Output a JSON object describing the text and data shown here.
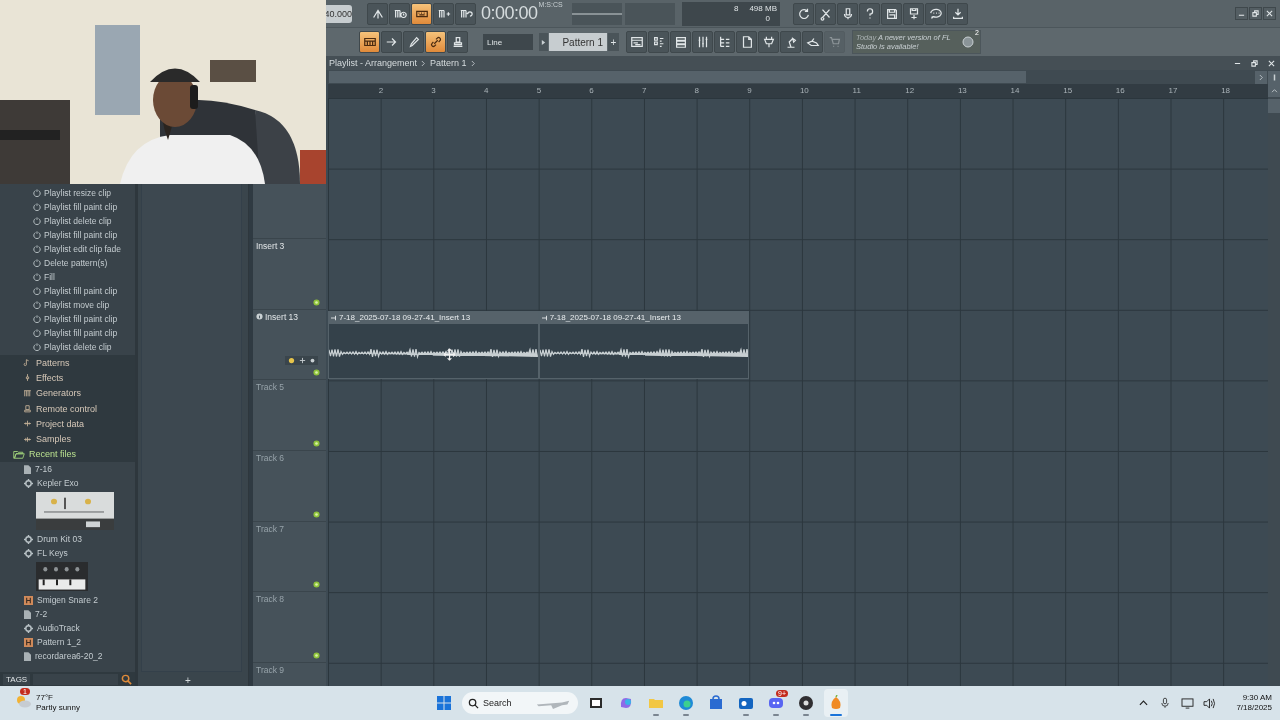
{
  "toolbar": {
    "tempo": "40.000",
    "buttons_row1": [
      {
        "on": false
      },
      {
        "on": false
      },
      {
        "on": true
      },
      {
        "on": false
      },
      {
        "on": false
      }
    ],
    "time": "0:00:00",
    "time_format": "M:S:CS",
    "cpu": "8",
    "memory": "498 MB",
    "polyphony": "0",
    "buttons_row2": [
      {
        "on": true
      },
      {
        "on": false
      },
      {
        "on": false
      },
      {
        "on": true
      },
      {
        "on": false
      }
    ],
    "snap": "Line",
    "pattern": "Pattern 1",
    "add": "+",
    "tools": [
      {
        "disabled": false
      },
      {
        "disabled": false
      },
      {
        "disabled": false
      },
      {
        "disabled": false
      },
      {
        "disabled": false
      },
      {
        "disabled": false
      },
      {
        "disabled": false
      },
      {
        "disabled": false
      },
      {
        "disabled": false
      },
      {
        "disabled": true
      }
    ],
    "news": {
      "date": "Today",
      "message": "A newer version of FL Studio is available!",
      "badge": "2"
    }
  },
  "browser": {
    "history": [
      "Playlist resize clip",
      "Playlist fill paint clip",
      "Playlist delete clip",
      "Playlist fill paint clip",
      "Playlist edit clip fade",
      "Delete pattern(s)",
      "Fill",
      "Playlist fill paint clip",
      "Playlist move clip",
      "Playlist fill paint clip",
      "Playlist fill paint clip",
      "Playlist delete clip"
    ],
    "folders": [
      {
        "label": "Patterns",
        "kind": "patterns"
      },
      {
        "label": "Effects",
        "kind": "effects"
      },
      {
        "label": "Generators",
        "kind": "generators"
      },
      {
        "label": "Remote control",
        "kind": "remote"
      },
      {
        "label": "Project data",
        "kind": "project"
      },
      {
        "label": "Samples",
        "kind": "samples"
      }
    ],
    "recent_files": {
      "label": "Recent files",
      "expanded": true,
      "children": [
        {
          "label": "7-16",
          "kind": "file"
        },
        {
          "label": "Kepler Exo",
          "kind": "plugin"
        },
        {
          "kind": "panel"
        },
        {
          "label": "Drum Kit 03",
          "kind": "plugin"
        },
        {
          "label": "FL Keys",
          "kind": "plugin"
        },
        {
          "kind": "keys"
        },
        {
          "label": "Smigen Snare 2",
          "kind": "pattern"
        },
        {
          "label": "7-2",
          "kind": "file"
        },
        {
          "label": "AudioTrack",
          "kind": "plugin"
        },
        {
          "label": "Pattern 1_2",
          "kind": "pattern"
        },
        {
          "label": "recordarea6-20_2",
          "kind": "file"
        }
      ]
    },
    "tags": "TAGS"
  },
  "side_panel": {
    "add": "+"
  },
  "playlist": {
    "title": "Playlist - Arrangement",
    "pattern": "Pattern 1",
    "ruler": [
      "2",
      "3",
      "4",
      "5",
      "6",
      "7",
      "8",
      "9",
      "10",
      "11",
      "12",
      "13",
      "14",
      "15",
      "16",
      "17",
      "18"
    ],
    "tracks": [
      {
        "label": "Insert 3",
        "kind": "named"
      },
      {
        "label": "Insert 13",
        "kind": "named",
        "clips": [
          {
            "name": "7-18_2025-07-18 09-27-41_Insert 13"
          },
          {
            "name": "7-18_2025-07-18 09-27-41_Insert 13"
          }
        ]
      },
      {
        "label": "Track 5",
        "kind": "default"
      },
      {
        "label": "Track 6",
        "kind": "default"
      },
      {
        "label": "Track 7",
        "kind": "default"
      },
      {
        "label": "Track 8",
        "kind": "default"
      },
      {
        "label": "Track 9",
        "kind": "default"
      }
    ]
  },
  "taskbar": {
    "weather": {
      "temp": "77°F",
      "condition": "Partly sunny",
      "badge": "1"
    },
    "search": {
      "placeholder": "Search"
    },
    "apps": [
      {
        "kind": "taskview",
        "running": false,
        "selected": false
      },
      {
        "kind": "copilot",
        "running": false,
        "selected": false
      },
      {
        "kind": "folder",
        "running": true,
        "selected": false
      },
      {
        "kind": "edge",
        "running": true,
        "selected": false
      },
      {
        "kind": "store",
        "running": false,
        "selected": false
      },
      {
        "kind": "outlook",
        "running": true,
        "selected": false
      },
      {
        "kind": "chat",
        "running": true,
        "selected": false,
        "badge": "9+"
      },
      {
        "kind": "recorder",
        "running": true,
        "selected": false
      },
      {
        "kind": "daw",
        "running": true,
        "selected": true
      }
    ],
    "time": "9:30 AM",
    "date": "7/18/2025"
  }
}
